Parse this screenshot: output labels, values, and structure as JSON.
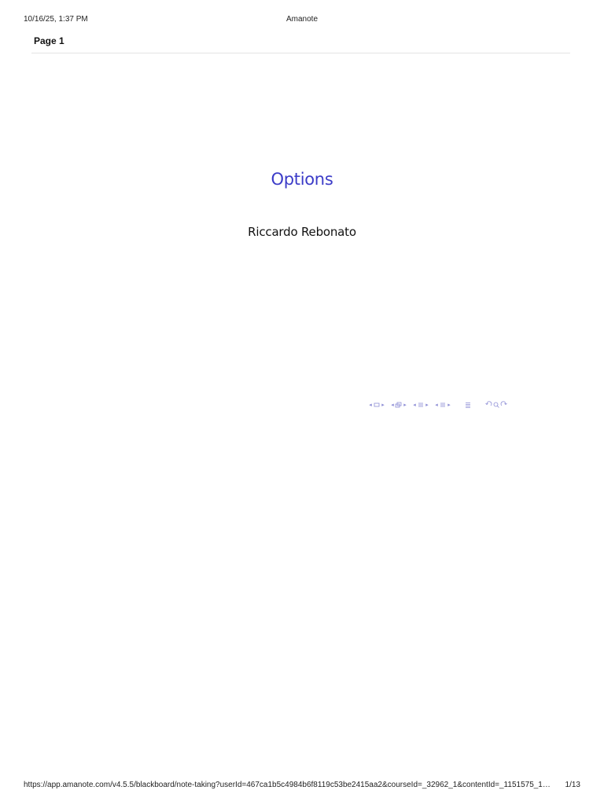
{
  "print_header": {
    "date": "10/16/25, 1:37 PM",
    "title": "Amanote"
  },
  "page_label": "Page 1",
  "slide": {
    "title": "Options",
    "author": "Riccardo Rebonato",
    "title_color": "#3c3cc8",
    "nav_color": "#8f8fd6",
    "nav_icons": [
      "frame-prev-icon",
      "frame-icon",
      "frame-next-icon",
      "subsection-prev-icon",
      "subsection-icon",
      "subsection-next-icon",
      "section-prev-icon",
      "section-icon",
      "section-next-icon",
      "section-alt-prev-icon",
      "section-alt-icon",
      "section-alt-next-icon",
      "toc-icon",
      "back-icon",
      "search-icon",
      "forward-icon"
    ]
  },
  "print_footer": {
    "url": "https://app.amanote.com/v4.5.5/blackboard/note-taking?userId=467ca1b5c4984b6f8119c53be2415aa2&courseId=_32962_1&contentId=_1151575_1…",
    "page_number": "1/13"
  }
}
